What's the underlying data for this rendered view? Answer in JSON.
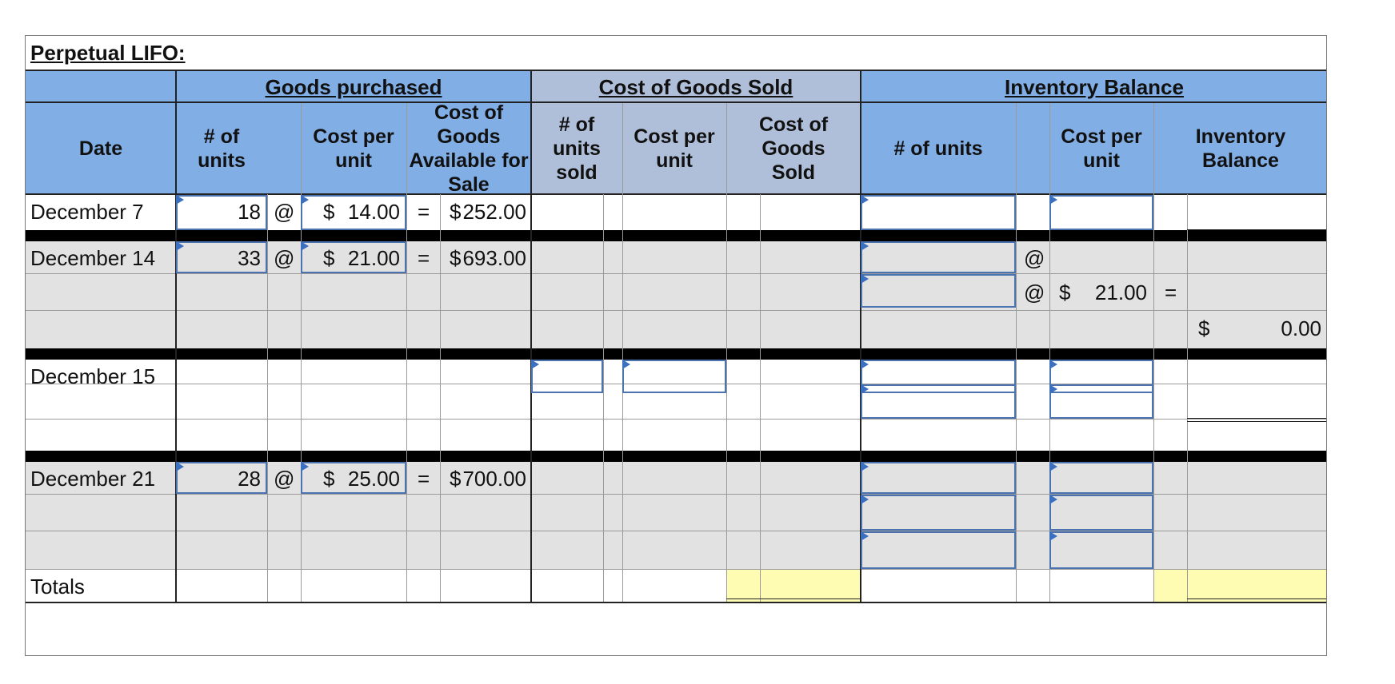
{
  "title": "Perpetual LIFO:",
  "groups": {
    "purchased": "Goods purchased",
    "cogs": "Cost of Goods Sold",
    "inventory": "Inventory Balance"
  },
  "columns": {
    "date": "Date",
    "units": "# of\nunits",
    "cost_per_unit": "Cost per\nunit",
    "available": "Cost of Goods\nAvailable for\nSale",
    "units_sold": "# of\nunits\nsold",
    "cogs_cost_per_unit": "Cost per\nunit",
    "cogs_total": "Cost of Goods\nSold",
    "inv_units": "# of units",
    "inv_cost_per_unit": "Cost per\nunit",
    "inv_balance": "Inventory\nBalance"
  },
  "symbols": {
    "at": "@",
    "eq": "=",
    "dollar": "$"
  },
  "rows": [
    {
      "date": "December 7",
      "units": "18",
      "cost": "14.00",
      "total": "252.00"
    },
    {
      "date": "December 14",
      "units": "33",
      "cost": "21.00",
      "total": "693.00",
      "inv_cost_row2": "21.00",
      "inv_balance_row3": "0.00"
    },
    {
      "date": "December 15"
    },
    {
      "date": "December 21",
      "units": "28",
      "cost": "25.00",
      "total": "700.00"
    },
    {
      "date": "Totals"
    }
  ]
}
